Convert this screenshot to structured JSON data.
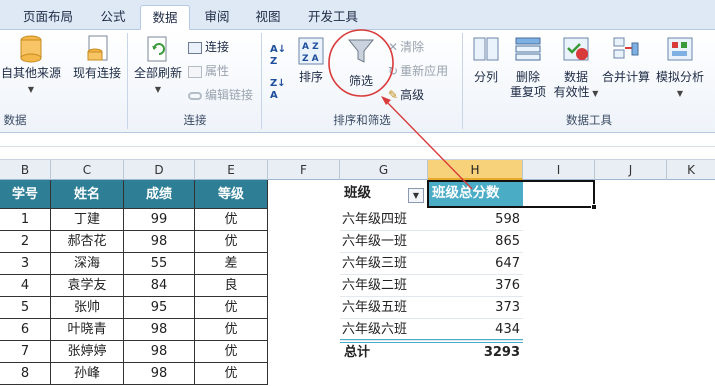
{
  "ribbon": {
    "tabs": [
      {
        "label": "页面布局",
        "active": false
      },
      {
        "label": "公式",
        "active": false
      },
      {
        "label": "数据",
        "active": true
      },
      {
        "label": "审阅",
        "active": false
      },
      {
        "label": "视图",
        "active": false
      },
      {
        "label": "开发工具",
        "active": false
      }
    ],
    "get_external": {
      "from_other_sources": "自其他来源",
      "existing_connections": "现有连接",
      "group_label": "数据"
    },
    "connections": {
      "refresh_all": "全部刷新",
      "connections": "连接",
      "properties": "属性",
      "edit_links": "编辑链接",
      "group_label": "连接"
    },
    "sort_filter": {
      "sort": "排序",
      "filter": "筛选",
      "clear": "清除",
      "reapply": "重新应用",
      "advanced": "高级",
      "group_label": "排序和筛选"
    },
    "data_tools": {
      "text_to_columns": "分列",
      "remove_duplicates_1": "删除",
      "remove_duplicates_2": "重复项",
      "data_validation_1": "数据",
      "data_validation_2": "有效性",
      "consolidate": "合并计算",
      "what_if": "模拟分析",
      "group_label": "数据工具"
    }
  },
  "columns": [
    "B",
    "C",
    "D",
    "E",
    "F",
    "G",
    "H",
    "I",
    "J",
    "K"
  ],
  "left_table": {
    "headers": [
      "学号",
      "姓名",
      "成绩",
      "等级"
    ],
    "header_color": "#2e7f96",
    "rows": [
      [
        "1",
        "丁建",
        "99",
        "优"
      ],
      [
        "2",
        "郝杏花",
        "98",
        "优"
      ],
      [
        "3",
        "深海",
        "55",
        "差"
      ],
      [
        "4",
        "袁学友",
        "84",
        "良"
      ],
      [
        "5",
        "张帅",
        "95",
        "优"
      ],
      [
        "6",
        "叶晓青",
        "98",
        "优"
      ],
      [
        "7",
        "张婷婷",
        "98",
        "优"
      ],
      [
        "8",
        "孙峰",
        "98",
        "优"
      ]
    ]
  },
  "right_table": {
    "header_class": "班级",
    "header_total": "班级总分数",
    "header_color": "#4bacc6",
    "rows": [
      {
        "name": "六年级四班",
        "score": "598"
      },
      {
        "name": "六年级一班",
        "score": "865"
      },
      {
        "name": "六年级三班",
        "score": "647"
      },
      {
        "name": "六年级二班",
        "score": "376"
      },
      {
        "name": "六年级五班",
        "score": "373"
      },
      {
        "name": "六年级六班",
        "score": "434"
      }
    ],
    "total_label": "总计",
    "total_value": "3293"
  },
  "annotation": {
    "circle_color": "#d93b3b",
    "arrow_color": "#d93b3b"
  }
}
